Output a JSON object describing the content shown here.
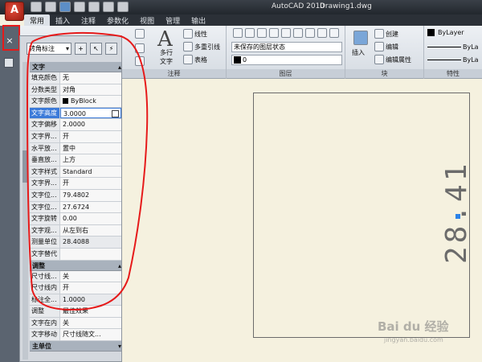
{
  "titlebar": {
    "app": "AutoCAD 2010",
    "file": "Drawing1.dwg"
  },
  "tabs": [
    "常用",
    "插入",
    "注释",
    "参数化",
    "视图",
    "管理",
    "输出"
  ],
  "ribbon": {
    "text_group": {
      "big_label": "多行\n文字",
      "multiline": "多行",
      "text_word": "文字",
      "linear": "线性",
      "multileader": "多重引线",
      "table": "表格",
      "caption": "注释"
    },
    "layer_group": {
      "layer_state": "未保存的图层状态",
      "layer_current": "0",
      "caption": "图层"
    },
    "block_group": {
      "insert": "插入",
      "create": "创建",
      "edit": "编辑",
      "edit_attr": "编辑属性",
      "caption": "块"
    },
    "props_group": {
      "color": "ByLayer",
      "linetype": "ByLa",
      "lineweight": "ByLa",
      "caption": "特性"
    }
  },
  "palette": {
    "combo": "转角标注",
    "sections": {
      "text": "文字",
      "adjust": "调整",
      "primary_units": "主单位"
    },
    "text_rows": [
      {
        "k": "填充颜色",
        "v": "无"
      },
      {
        "k": "分数类型",
        "v": "对角"
      },
      {
        "k": "文字颜色",
        "v": "ByBlock"
      },
      {
        "k": "文字高度",
        "v": "3.0000"
      },
      {
        "k": "文字偏移",
        "v": "2.0000"
      },
      {
        "k": "文字界...",
        "v": "开"
      },
      {
        "k": "水平放...",
        "v": "置中"
      },
      {
        "k": "垂直放...",
        "v": "上方"
      },
      {
        "k": "文字样式",
        "v": "Standard"
      },
      {
        "k": "文字界...",
        "v": "开"
      },
      {
        "k": "文字位...",
        "v": "79.4802"
      },
      {
        "k": "文字位...",
        "v": "27.6724"
      },
      {
        "k": "文字旋转",
        "v": "0.00"
      },
      {
        "k": "文字观...",
        "v": "从左到右"
      },
      {
        "k": "测量单位",
        "v": "28.4088"
      },
      {
        "k": "文字替代",
        "v": ""
      }
    ],
    "adjust_rows": [
      {
        "k": "尺寸线...",
        "v": "关"
      },
      {
        "k": "尺寸线内",
        "v": "开"
      },
      {
        "k": "标注全...",
        "v": "1.0000"
      },
      {
        "k": "调整",
        "v": "最佳效果"
      },
      {
        "k": "文字在内",
        "v": "关"
      },
      {
        "k": "文字移动",
        "v": "尺寸线随文..."
      }
    ]
  },
  "leftstrip": {
    "close": "×",
    "side_label": "特性"
  },
  "drawing": {
    "dimension": "28.41"
  },
  "watermark": {
    "brand": "Bai du 经验",
    "url": "jingyan.baidu.com"
  },
  "colors": {
    "annotation": "#e61a1a",
    "selected_row": "#3b7ad9",
    "grip": "#2b82e8"
  }
}
